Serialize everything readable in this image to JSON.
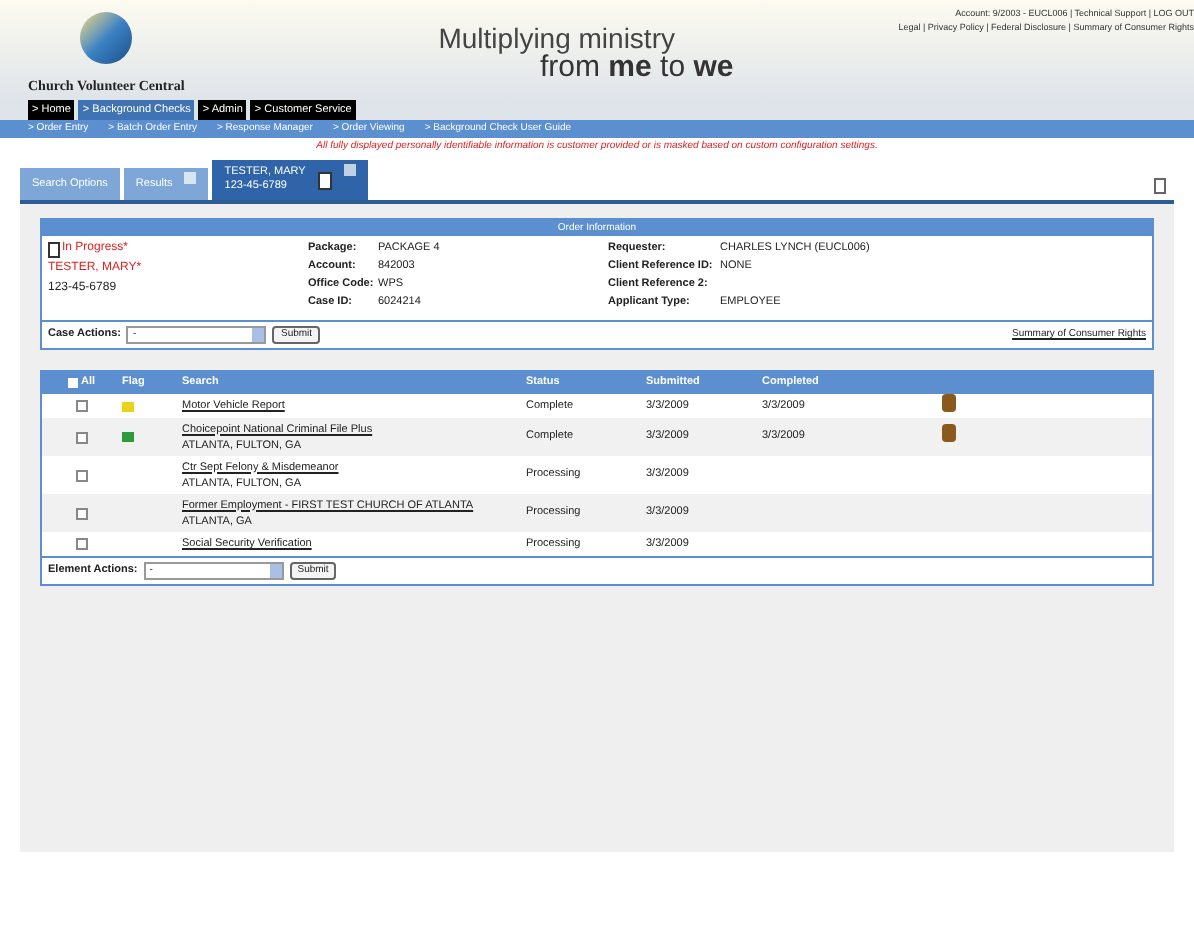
{
  "header": {
    "brand": "Church Volunteer Central",
    "slogan_line_1": "Multiplying ministry",
    "slogan_line_2": "from **me** to **we**",
    "account_line": "Account: 9/2003 - EUCL006 | Technical Support | LOG OUT",
    "legal_line": "Legal | Privacy Policy | Federal Disclosure | Summary of Consumer Rights"
  },
  "main_nav": [
    {
      "label": "> Home",
      "selected": false
    },
    {
      "label": "> Background Checks",
      "selected": true
    },
    {
      "label": "> Admin",
      "selected": false
    },
    {
      "label": "> Customer Service",
      "selected": false
    }
  ],
  "sub_nav": [
    "> Order Entry",
    "> Batch Order Entry",
    "> Response Manager",
    "> Order Viewing",
    "> Background Check User Guide"
  ],
  "notice": "All fully displayed personally identifiable information is customer provided or is masked based on custom configuration settings.",
  "tabs": [
    {
      "label": "Search Options",
      "selected": false,
      "closable": false
    },
    {
      "label": "Results",
      "selected": false,
      "closable": true
    },
    {
      "label": "TESTER, MARY",
      "sublabel": "123-45-6789",
      "selected": true,
      "closable": true
    }
  ],
  "order_info": {
    "title": "Order Information",
    "status": "In Progress*",
    "applicant": "TESTER, MARY*",
    "ssn": "123-45-6789",
    "fields_1": [
      {
        "label": "Package:",
        "value": "PACKAGE 4"
      },
      {
        "label": "Account:",
        "value": "842003"
      },
      {
        "label": "Office Code:",
        "value": "WPS"
      },
      {
        "label": "Case ID:",
        "value": "6024214"
      }
    ],
    "fields_2": [
      {
        "label": "Requester:",
        "value": "CHARLES LYNCH (EUCL006)"
      },
      {
        "label": "Client Reference ID:",
        "value": "NONE"
      },
      {
        "label": "Client Reference 2:"
      },
      {
        "label": "Applicant Type:",
        "value": "EMPLOYEE"
      }
    ]
  },
  "case_actions": {
    "label": "Case Actions:",
    "value": "-",
    "button": "Submit",
    "link": "Summary of Consumer Rights"
  },
  "table": {
    "all_checked": false,
    "columns": [
      "All",
      "Flag",
      "Search",
      "Status",
      "Submitted",
      "Completed"
    ],
    "rows": [
      {
        "checked": false,
        "color": "#e8d21a",
        "search": "Motor Vehicle Report",
        "status": "Complete",
        "submitted": "3/3/2009",
        "completed": "3/3/2009",
        "result_icon": true
      },
      {
        "checked": false,
        "color": "#2e9a3a",
        "search": "Choicepoint National Criminal File Plus",
        "location": "ATLANTA, FULTON, GA",
        "status": "Complete",
        "submitted": "3/3/2009",
        "completed": "3/3/2009",
        "result_icon": true
      },
      {
        "checked": false,
        "search": "Ctr Sept Felony & Misdemeanor",
        "location": "ATLANTA, FULTON, GA",
        "status": "Processing",
        "submitted": "3/3/2009",
        "result_icon": false
      },
      {
        "checked": false,
        "search": "Former Employment - FIRST TEST CHURCH OF ATLANTA",
        "location": "ATLANTA, GA",
        "status": "Processing",
        "submitted": "3/3/2009",
        "result_icon": false
      },
      {
        "checked": false,
        "search": "Social Security Verification",
        "status": "Processing",
        "submitted": "3/3/2009",
        "result_icon": false
      }
    ]
  },
  "element_actions": {
    "label": "Element Actions:",
    "value": "-",
    "button": "Submit"
  }
}
